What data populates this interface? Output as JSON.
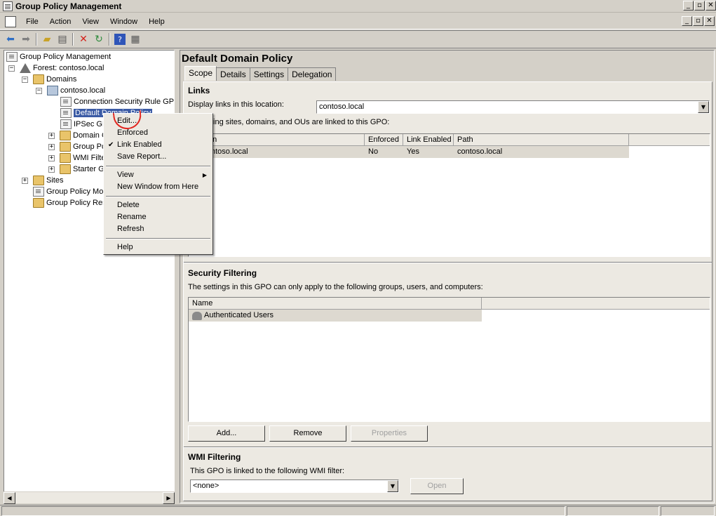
{
  "window": {
    "title": "Group Policy Management",
    "controls": {
      "minimize": "_",
      "restore": "▫",
      "close": "✕"
    }
  },
  "menubar": {
    "items": [
      "File",
      "Action",
      "View",
      "Window",
      "Help"
    ]
  },
  "toolbar": {
    "icons": [
      "back-icon",
      "forward-icon",
      "up-folder-icon",
      "show-hide-tree-icon",
      "delete-icon",
      "refresh-icon",
      "help-icon",
      "properties-icon"
    ]
  },
  "tree": {
    "root": "Group Policy Management",
    "forest": "Forest: contoso.local",
    "domains": "Domains",
    "domain": "contoso.local",
    "gpo_connection": "Connection Security Rule GPO",
    "gpo_default": "Default Domain Policy",
    "gpo_ipsec": "IPSec GP",
    "domain_controllers": "Domain C",
    "group_policy_objects": "Group Po",
    "wmi_filters": "WMI Filte",
    "starter_gpos": "Starter G",
    "sites": "Sites",
    "modeling": "Group Policy Moc",
    "results": "Group Policy Res"
  },
  "context_menu": {
    "edit": "Edit...",
    "enforced": "Enforced",
    "link_enabled": "Link Enabled",
    "link_enabled_checked": true,
    "save_report": "Save Report...",
    "view": "View",
    "new_window": "New Window from Here",
    "delete": "Delete",
    "rename": "Rename",
    "refresh": "Refresh",
    "help": "Help"
  },
  "details": {
    "title": "Default Domain Policy",
    "tabs": [
      "Scope",
      "Details",
      "Settings",
      "Delegation"
    ],
    "active_tab": "Scope",
    "links": {
      "heading": "Links",
      "location_label": "Display links in this location:",
      "location_value": "contoso.local",
      "linked_text": "owing sites, domains, and OUs are linked to this GPO:",
      "columns": [
        "on",
        "Enforced",
        "Link Enabled",
        "Path"
      ],
      "rows": [
        {
          "location": "ntoso.local",
          "enforced": "No",
          "link_enabled": "Yes",
          "path": "contoso.local"
        }
      ]
    },
    "security_filtering": {
      "heading": "Security Filtering",
      "description": "The settings in this GPO can only apply to the following groups, users, and computers:",
      "columns": [
        "Name"
      ],
      "rows": [
        "Authenticated Users"
      ],
      "buttons": {
        "add": "Add...",
        "remove": "Remove",
        "properties": "Properties"
      }
    },
    "wmi_filtering": {
      "heading": "WMI Filtering",
      "description": "This GPO is linked to the following WMI filter:",
      "filter_value": "<none>",
      "open_button": "Open"
    }
  }
}
